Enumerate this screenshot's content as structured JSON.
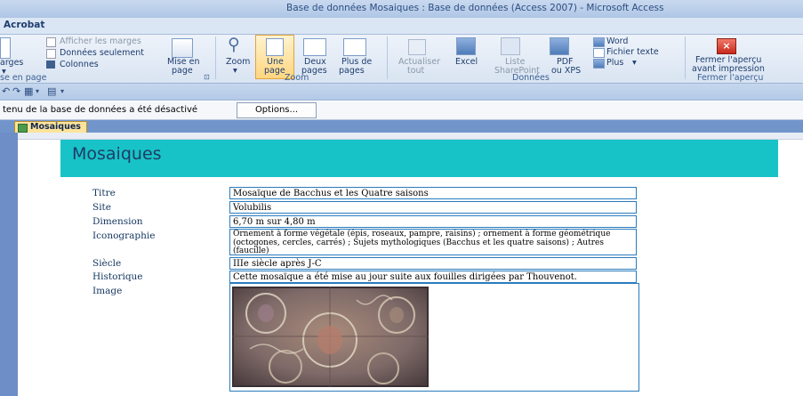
{
  "window": {
    "title": "Base de données Mosaiques : Base de données (Access 2007) - Microsoft Access"
  },
  "tabs": {
    "active": "Acrobat"
  },
  "ribbon": {
    "mise_en_page": {
      "group_label": "se en page",
      "marges": "arges",
      "afficher_marges": "Afficher les marges",
      "donnees_seulement": "Données seulement",
      "colonnes": "Colonnes",
      "mise_en_page_btn": [
        "Mise en",
        "page"
      ]
    },
    "zoom": {
      "group_label": "Zoom",
      "zoom_btn": "Zoom",
      "une_page": [
        "Une",
        "page"
      ],
      "deux_pages": [
        "Deux",
        "pages"
      ],
      "plus_de_pages": [
        "Plus de",
        "pages"
      ]
    },
    "donnees": {
      "group_label": "Données",
      "actualiser": [
        "Actualiser",
        "tout"
      ],
      "excel": "Excel",
      "liste_sharepoint": [
        "Liste",
        "SharePoint"
      ],
      "pdf_xps": [
        "PDF",
        "ou XPS"
      ],
      "word": "Word",
      "fichier_texte": "Fichier texte",
      "plus": "Plus"
    },
    "fermer": {
      "group_label": "Fermer l'aperçu",
      "fermer_btn": [
        "Fermer l'aperçu",
        "avant impression"
      ]
    }
  },
  "security_bar": {
    "message": "tenu de la base de données a été désactivé",
    "options_label": "Options..."
  },
  "document_tab": {
    "label": "Mosaiques"
  },
  "report": {
    "title": "Mosaiques",
    "fields": [
      {
        "label": "Titre",
        "value": "Mosaïque de Bacchus et les Quatre saisons"
      },
      {
        "label": "Site",
        "value": "Volubilis"
      },
      {
        "label": "Dimension",
        "value": "6,70 m sur 4,80 m"
      },
      {
        "label": "Iconographie",
        "value": "Ornement à forme végétale (épis, roseaux, pampre, raisins) ; ornement à forme géométrique (octogones, cercles, carrés) ; Sujets mythologiques (Bacchus et les quatre saisons) ; Autres (faucille)"
      },
      {
        "label": "Siècle",
        "value": "IIIe siècle après J-C"
      },
      {
        "label": "Historique",
        "value": "Cette mosaïque a été mise au jour suite aux fouilles dirigées par Thouvenot."
      },
      {
        "label": "Image",
        "value": ""
      }
    ]
  },
  "colors": {
    "title_band": "#18c3c8",
    "field_border": "#2a7bbd",
    "ribbon_active": "#ffd680"
  }
}
